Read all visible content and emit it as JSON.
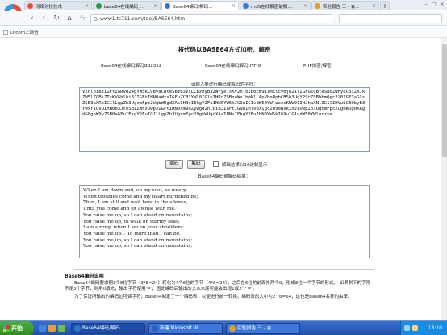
{
  "browser": {
    "tabs": [
      {
        "label": "网络对抗技术",
        "active": false,
        "icon_color": "#e44b3a"
      },
      {
        "label": "base64在线编码_...",
        "active": false,
        "icon_color": "#2a9a41"
      },
      {
        "label": "Base64编码/解码...",
        "active": true,
        "icon_color": "#2b78c8"
      },
      {
        "label": "md5在线解密破解,...",
        "active": false,
        "icon_color": "#3a7ad0"
      },
      {
        "label": "实验报告 三 - 会...",
        "active": false,
        "icon_color": "#e0a020"
      }
    ],
    "new_tab": "+",
    "url": "www1.tc711.com/tool/BASE64.htm",
    "bookmark": "Drcom上网信"
  },
  "page": {
    "title": "将代码以BASE64方式加密、解密",
    "modes": [
      "Base64在线编码解码GB2312",
      "Base64在线编码解码UTF-8",
      "PHP加密/解密"
    ],
    "input_prompt": "请输入要进行编码或解码的字符：",
    "input_text": "V2hlbiBJIGFtIGRvd24gYW5kLCBvaCBteSBzb3VsLCBzbyB3ZWFyeTsKV2hlbiB0cm91YmxlcyBjb21lIGFuZCBteSBoZWFydCBiZXJkZW5lZCBiZTsKVGhlbiBJIGFtIHN0aWxsIGFuZCB3YWl0IGluIHRoZSBzaWxlbmNlLApVbnRpbCB5b3UgY29tZSBhbmQgc2l0IGF3aGlsZSB3aXRoIG1lLgpZb3UgcmFpc2UgbWUgdXAsIHNvIEkgY2FuIHN0YW5kIG9uIG1vdW50YWluczsKWW91IHJhaXNlIG1lIHVwLCB0byB3YWxrIG9uIHN0b3JteSBzZWFzOwpJIGFtIHN0cm9uZywgd2hlbiBJIGFtIG9uIHlvdXIgc2hvdWxkZXJzOwpZb3UgcmFpc2UgbWUgdXAgdG8gbW9yZSB0aGFuIEkgY2FuIGJlLgpZb3UgcmFpc2UgbWUgdXAsIHNvIEkgY2FuIHN0YW5kIG9uIG1vdW50YWluczs=",
    "encode_button": "编码",
    "decode_button": "解码",
    "hex_label": "解码结果以16进制显示",
    "result_prompt": "Base64编码或解码结果：",
    "output_lines": [
      "When I am down and, oh my soul, so weary;",
      "When troubles come and my heart burdened be;",
      "Then, I am still and wait here in the silence,",
      "Until you come and sit awhile with me.",
      "You raise me up, so I can stand on mountains;",
      "You raise me up, to walk on stormy seas;",
      "I am strong, when I am on your shoulders;",
      "You raise me up… To more than I can be.",
      "You raise me up, so I can stand on mountains;",
      "You raise me up, so I can stand on mountains;"
    ],
    "desc_title": "Base64编码说明",
    "desc_paras": [
      "Base64编码要求把3个8位字节（3*8=24）转化为4个6位的字节（4*6=24），之后在6位的前面补两个0，形成8位一个字节的形式。 如果剩下的字符不足3个字节，则用0填充，输出字符使用'='，因此编码后输出的文本末尾可能会出现1或2个'='。",
      "为了保证所输出的编码位可读字符，Base64制定了一个编码表，以便进行统一转换。编码表的大小为2^6=64，这也是Base64名称的由来。"
    ]
  },
  "taskbar": {
    "start_label": "开始",
    "tasks": [
      {
        "label": "Base64编码/解码...",
        "active": true,
        "icon_color": "#2b78c8"
      },
      {
        "label": "新建 Microsoft W...",
        "active": false,
        "icon_color": "#2b5fc0"
      },
      {
        "label": "实验报告 三 - 会...",
        "active": false,
        "icon_color": "#e0a020"
      }
    ],
    "clock": "18:10"
  }
}
